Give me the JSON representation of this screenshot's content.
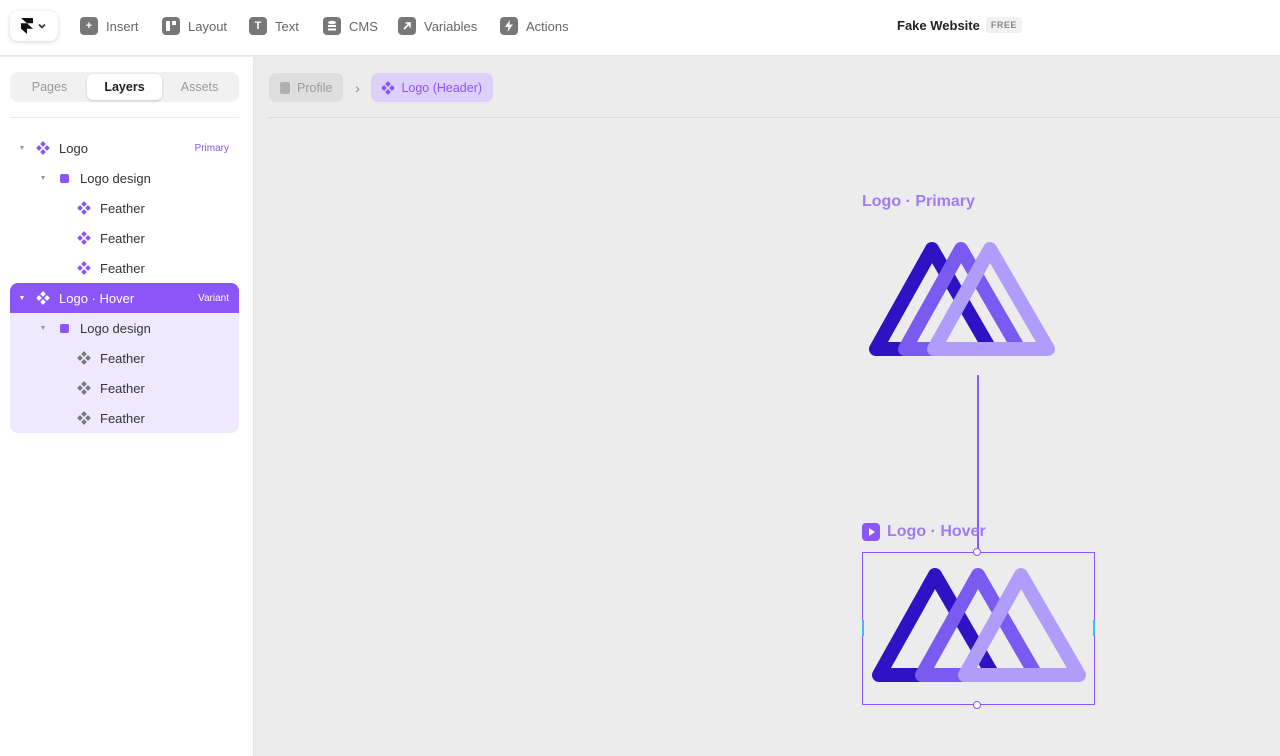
{
  "toolbar": {
    "tools": [
      {
        "label": "Insert",
        "icon": "plus-icon"
      },
      {
        "label": "Layout",
        "icon": "layout-icon"
      },
      {
        "label": "Text",
        "icon": "text-icon"
      },
      {
        "label": "CMS",
        "icon": "database-icon"
      },
      {
        "label": "Variables",
        "icon": "arrow-up-right-icon"
      },
      {
        "label": "Actions",
        "icon": "bolt-icon"
      }
    ],
    "site_name": "Fake Website",
    "plan_badge": "FREE"
  },
  "sidebar": {
    "tabs": [
      "Pages",
      "Layers",
      "Assets"
    ],
    "active_tab": "Layers",
    "layers": [
      {
        "label": "Logo",
        "tag": "Primary"
      },
      {
        "label": "Logo design"
      },
      {
        "label": "Feather"
      },
      {
        "label": "Feather"
      },
      {
        "label": "Feather"
      },
      {
        "label": "Logo · Hover",
        "tag": "Variant",
        "selected": true
      },
      {
        "label": "Logo design"
      },
      {
        "label": "Feather"
      },
      {
        "label": "Feather"
      },
      {
        "label": "Feather"
      }
    ]
  },
  "canvas": {
    "breadcrumbs": [
      "Profile",
      "Logo (Header)"
    ],
    "primary_label": "Logo · Primary",
    "hover_label": "Logo · Hover"
  },
  "colors": {
    "accent": "#8b55f7",
    "logo_dark": "#2e12c4",
    "logo_mid": "#7a5af0",
    "logo_light": "#b09cfb"
  }
}
